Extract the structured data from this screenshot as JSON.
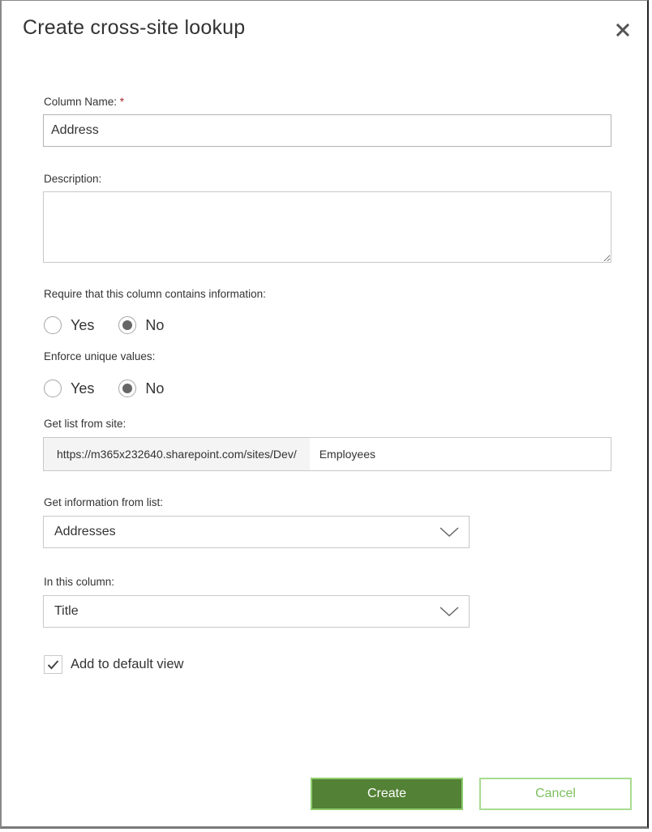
{
  "dialog": {
    "title": "Create cross-site lookup",
    "close_icon": "close-icon"
  },
  "form": {
    "column_name": {
      "label": "Column Name:",
      "required_marker": "*",
      "value": "Address"
    },
    "description": {
      "label": "Description:",
      "value": ""
    },
    "require_info": {
      "label": "Require that this column contains information:",
      "options": [
        {
          "label": "Yes",
          "selected": false
        },
        {
          "label": "No",
          "selected": true
        }
      ]
    },
    "enforce_unique": {
      "label": "Enforce unique values:",
      "options": [
        {
          "label": "Yes",
          "selected": false
        },
        {
          "label": "No",
          "selected": true
        }
      ]
    },
    "site": {
      "label": "Get list from site:",
      "prefix": "https://m365x232640.sharepoint.com/sites/Dev/",
      "value": "Employees"
    },
    "list": {
      "label": "Get information from list:",
      "selected": "Addresses"
    },
    "column": {
      "label": "In this column:",
      "selected": "Title"
    },
    "default_view": {
      "label": "Add to default view",
      "checked": true
    }
  },
  "buttons": {
    "create": "Create",
    "cancel": "Cancel"
  },
  "colors": {
    "primary": "#538135",
    "primary_border": "#8dcc6c",
    "cancel_text": "#7cbf5f"
  }
}
